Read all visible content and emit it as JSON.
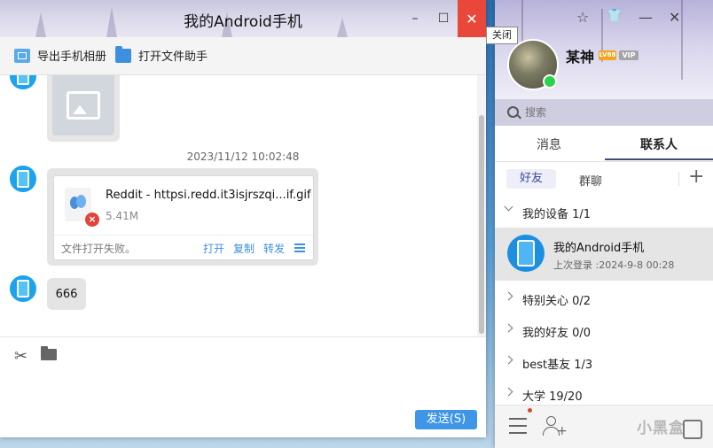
{
  "chat": {
    "title": "我的Android手机",
    "window_controls": {
      "minimize": "–",
      "maximize": "☐",
      "close": "✕"
    },
    "toolbar": {
      "export_album": "导出手机相册",
      "open_file_helper": "打开文件助手"
    },
    "timestamp": "2023/11/12 10:02:48",
    "file_message": {
      "file_name": "Reddit - httpsi.redd.it3isjrszqi...if.gif",
      "file_size": "5.41M",
      "status": "文件打开失败。",
      "actions": {
        "open": "打开",
        "copy": "复制",
        "forward": "转发"
      }
    },
    "text_message": "666",
    "send_button": "发送(S)"
  },
  "panel": {
    "tooltip_close": "关闭",
    "header_buttons": {
      "skin": "☆",
      "shirt": "👕",
      "minimize": "—",
      "close": "✕"
    },
    "user": {
      "name": "某神",
      "level_badge": "LV88",
      "vip_badge": "VIP"
    },
    "search": {
      "placeholder": "搜索"
    },
    "tabs": {
      "messages": "消息",
      "contacts": "联系人"
    },
    "subtabs": {
      "friends": "好友",
      "groups": "群聊",
      "add": "+"
    },
    "groups": [
      {
        "label": "我的设备 1/1",
        "expanded": true
      },
      {
        "label": "特别关心 0/2",
        "expanded": false
      },
      {
        "label": "我的好友 0/0",
        "expanded": false
      },
      {
        "label": "best基友 1/3",
        "expanded": false
      },
      {
        "label": "大学 19/20",
        "expanded": false
      }
    ],
    "device": {
      "name": "我的Android手机",
      "last_login": "上次登录 :2024-9-8 00:28"
    },
    "watermark": "小黑盒"
  }
}
